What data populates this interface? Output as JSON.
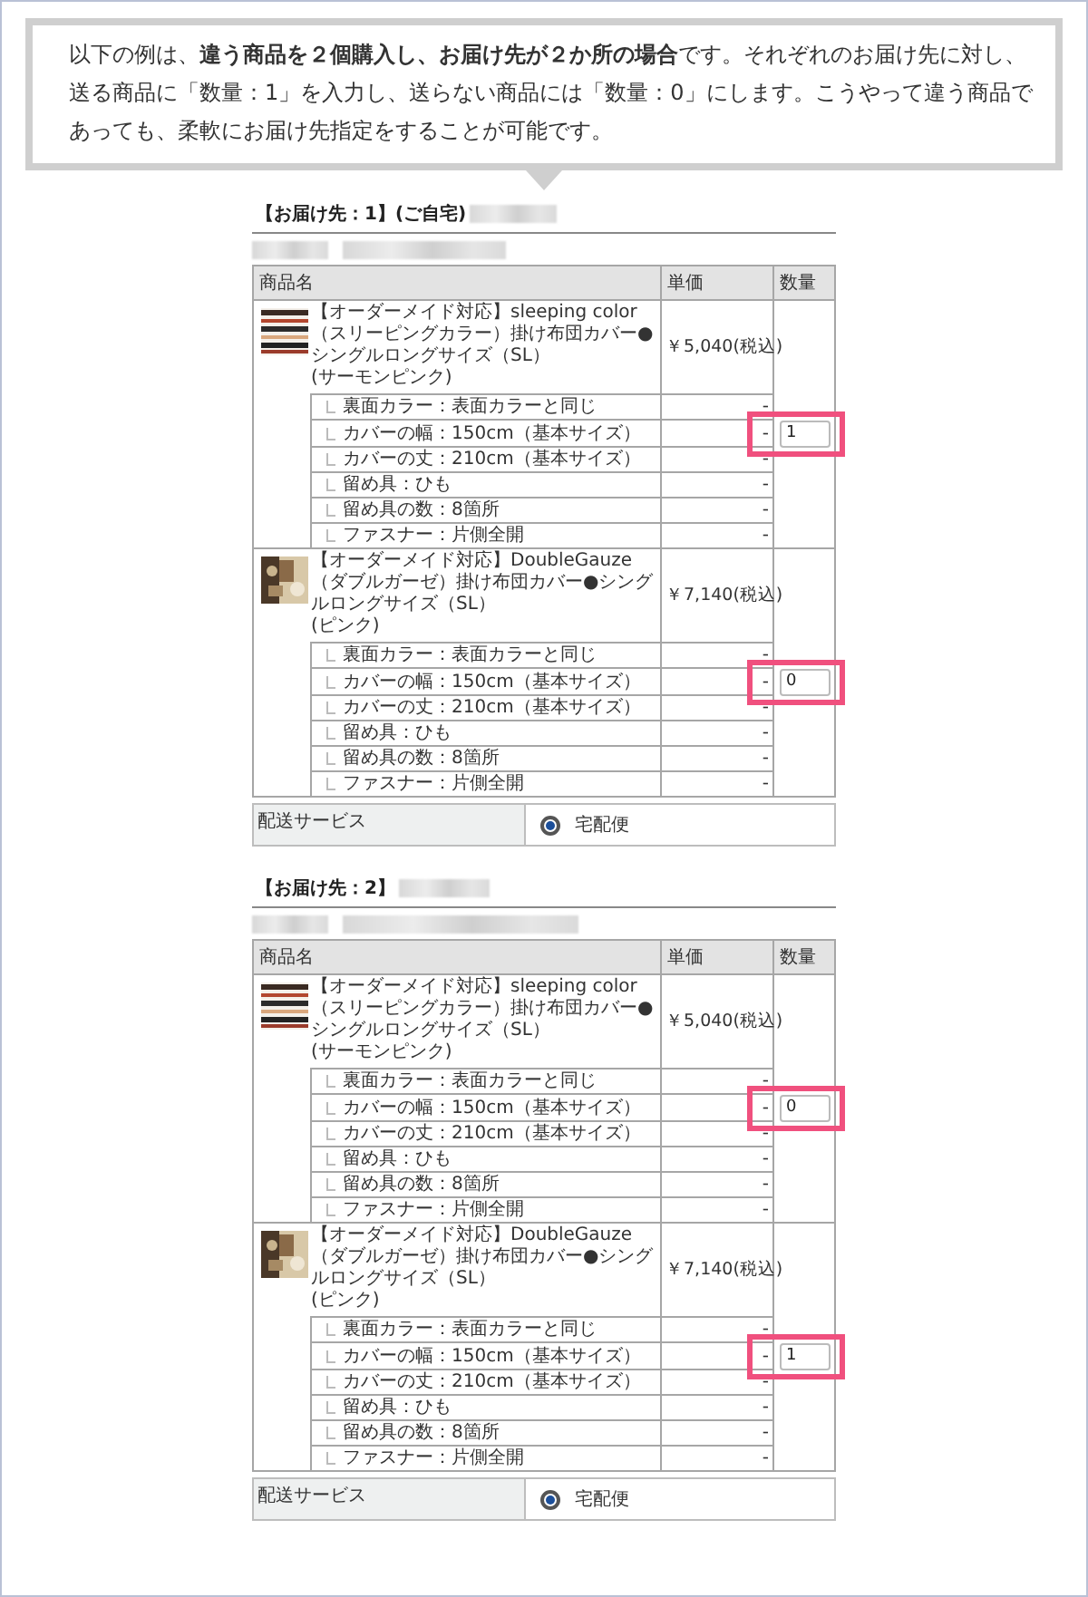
{
  "callout": {
    "text": "以下の例は、**違う商品を２個購入し、お届け先が２か所の場合**です。それぞれのお届け先に対し、送る商品に「数量：1」を入力し、送らない商品には「数量：0」にします。こうやって違う商品であっても、柔軟にお届け先指定をすることが可能です。"
  },
  "destinations": [
    {
      "heading": "【お届け先：1】(ご自宅)",
      "columns": [
        "商品名",
        "単価",
        "数量"
      ],
      "products": [
        {
          "name": "【オーダーメイド対応】sleeping color（スリーピングカラー）掛け布団カバー●シングルロングサイズ（SL）",
          "variant": "(サーモンピンク)",
          "price": "￥5,040(税込)",
          "quantity": "1",
          "highlighted": true,
          "options": [
            {
              "text": "裏面カラー：表面カラーと同じ",
              "price": "-"
            },
            {
              "text": "カバーの幅：150cm（基本サイズ）",
              "price": "-"
            },
            {
              "text": "カバーの丈：210cm（基本サイズ）",
              "price": "-"
            },
            {
              "text": "留め具：ひも",
              "price": "-"
            },
            {
              "text": "留め具の数：8箇所",
              "price": "-"
            },
            {
              "text": "ファスナー：片側全開",
              "price": "-"
            }
          ]
        },
        {
          "name": "【オーダーメイド対応】DoubleGauze（ダブルガーゼ）掛け布団カバー●シングルロングサイズ（SL）",
          "variant": "(ピンク)",
          "price": "￥7,140(税込)",
          "quantity": "0",
          "highlighted": true,
          "options": [
            {
              "text": "裏面カラー：表面カラーと同じ",
              "price": "-"
            },
            {
              "text": "カバーの幅：150cm（基本サイズ）",
              "price": "-"
            },
            {
              "text": "カバーの丈：210cm（基本サイズ）",
              "price": "-"
            },
            {
              "text": "留め具：ひも",
              "price": "-"
            },
            {
              "text": "留め具の数：8箇所",
              "price": "-"
            },
            {
              "text": "ファスナー：片側全開",
              "price": "-"
            }
          ]
        }
      ],
      "shipping": {
        "label": "配送サービス",
        "option": "宅配便",
        "selected": true
      }
    },
    {
      "heading": "【お届け先：2】",
      "columns": [
        "商品名",
        "単価",
        "数量"
      ],
      "products": [
        {
          "name": "【オーダーメイド対応】sleeping color（スリーピングカラー）掛け布団カバー●シングルロングサイズ（SL）",
          "variant": "(サーモンピンク)",
          "price": "￥5,040(税込)",
          "quantity": "0",
          "highlighted": true,
          "options": [
            {
              "text": "裏面カラー：表面カラーと同じ",
              "price": "-"
            },
            {
              "text": "カバーの幅：150cm（基本サイズ）",
              "price": "-"
            },
            {
              "text": "カバーの丈：210cm（基本サイズ）",
              "price": "-"
            },
            {
              "text": "留め具：ひも",
              "price": "-"
            },
            {
              "text": "留め具の数：8箇所",
              "price": "-"
            },
            {
              "text": "ファスナー：片側全開",
              "price": "-"
            }
          ]
        },
        {
          "name": "【オーダーメイド対応】DoubleGauze（ダブルガーゼ）掛け布団カバー●シングルロングサイズ（SL）",
          "variant": "(ピンク)",
          "price": "￥7,140(税込)",
          "quantity": "1",
          "highlighted": true,
          "options": [
            {
              "text": "裏面カラー：表面カラーと同じ",
              "price": "-"
            },
            {
              "text": "カバーの幅：150cm（基本サイズ）",
              "price": "-"
            },
            {
              "text": "カバーの丈：210cm（基本サイズ）",
              "price": "-"
            },
            {
              "text": "留め具：ひも",
              "price": "-"
            },
            {
              "text": "留め具の数：8箇所",
              "price": "-"
            },
            {
              "text": "ファスナー：片側全開",
              "price": "-"
            }
          ]
        }
      ],
      "shipping": {
        "label": "配送サービス",
        "option": "宅配便",
        "selected": true
      }
    }
  ]
}
